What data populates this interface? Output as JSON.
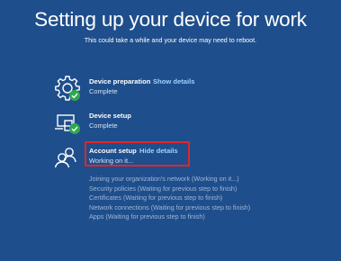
{
  "header": {
    "title": "Setting up your device for work",
    "subtitle": "This could take a while and your device may need to reboot."
  },
  "steps": [
    {
      "name": "Device preparation",
      "link": "Show details",
      "status": "Complete",
      "icon": "gear-icon",
      "complete": true
    },
    {
      "name": "Device setup",
      "status": "Complete",
      "icon": "laptop-icon",
      "complete": true
    },
    {
      "name": "Account setup",
      "link": "Hide details",
      "status": "Working on it...",
      "icon": "people-icon",
      "complete": false
    }
  ],
  "details": [
    "Joining your organization's network (Working on it...)",
    "Security policies (Waiting for previous step to finish)",
    "Certificates (Waiting for previous step to finish)",
    "Network connections (Waiting for previous step to finish)",
    "Apps (Waiting for previous step to finish)"
  ],
  "colors": {
    "background": "#1f4e8c",
    "link": "#9fd3ff",
    "check": "#2fa84f",
    "highlight": "#e0262b"
  }
}
